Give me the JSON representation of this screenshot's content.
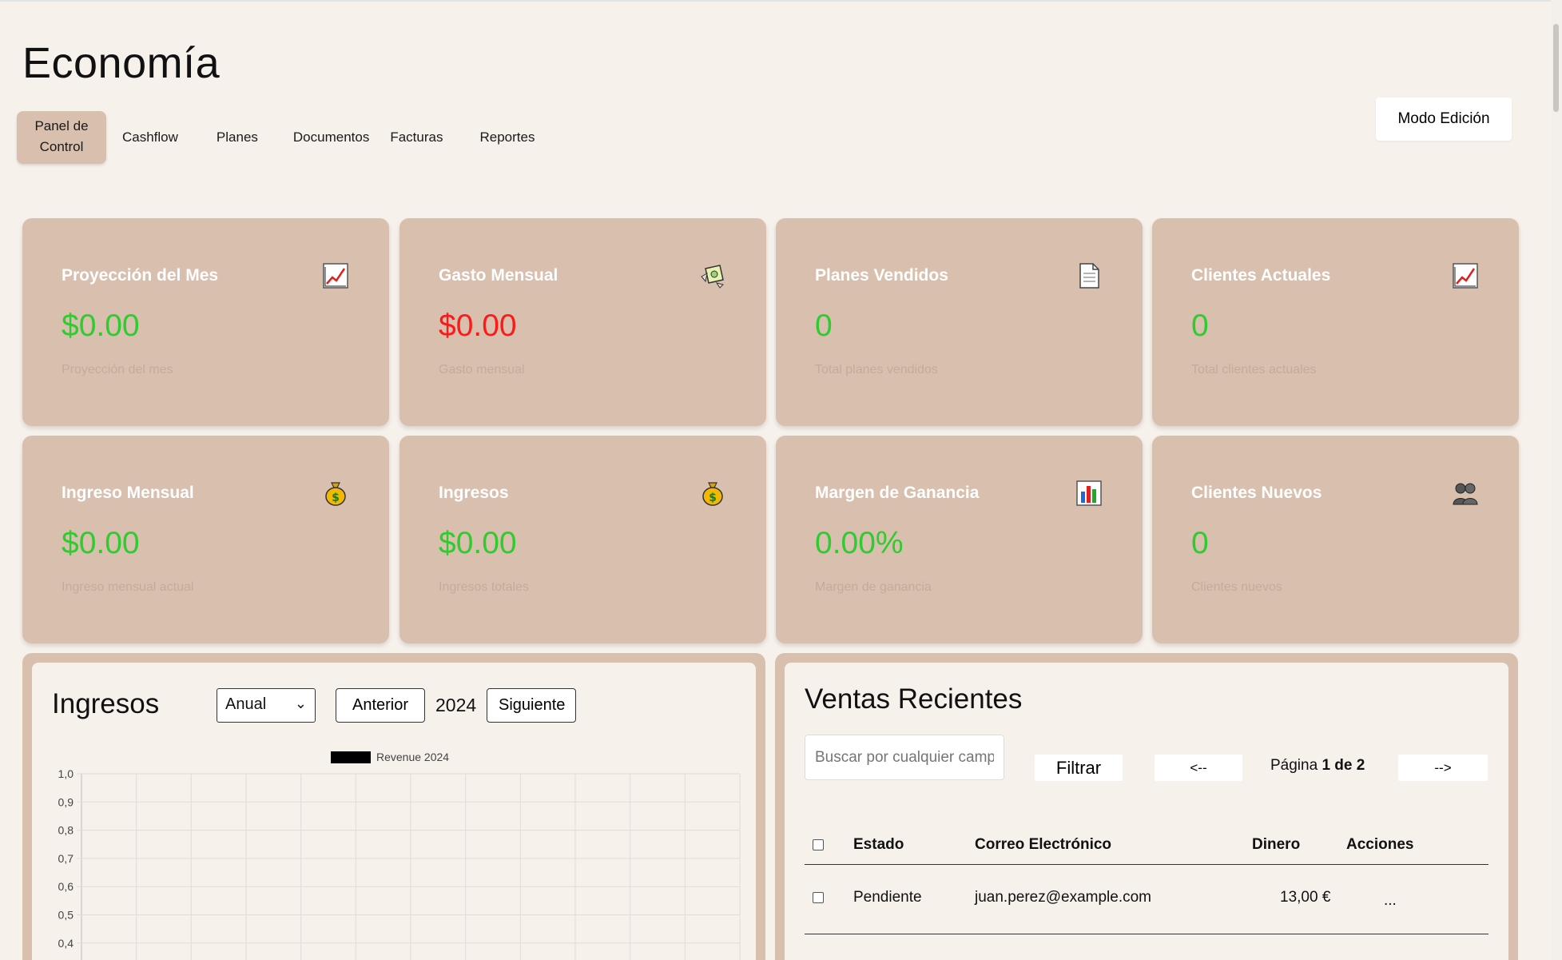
{
  "app": {
    "title": "Economía",
    "mode_button": "Modo Edición"
  },
  "tabs": [
    {
      "label": "Panel de\nControl",
      "active": true
    },
    {
      "label": "Cashflow",
      "active": false
    },
    {
      "label": "Planes",
      "active": false
    },
    {
      "label": "Documentos",
      "active": false
    },
    {
      "label": "Facturas",
      "active": false
    },
    {
      "label": "Reportes",
      "active": false
    }
  ],
  "cards": [
    {
      "title": "Proyección del Mes",
      "value": "$0.00",
      "subtitle": "Proyección del mes",
      "icon": "chart-increasing-icon",
      "value_color": "green"
    },
    {
      "title": "Gasto Mensual",
      "value": "$0.00",
      "subtitle": "Gasto mensual",
      "icon": "money-with-wings-icon",
      "value_color": "red"
    },
    {
      "title": "Planes Vendidos",
      "value": "0",
      "subtitle": "Total planes vendidos",
      "icon": "document-icon",
      "value_color": "green"
    },
    {
      "title": "Clientes Actuales",
      "value": "0",
      "subtitle": "Total clientes actuales",
      "icon": "chart-increasing-icon",
      "value_color": "green"
    },
    {
      "title": "Ingreso Mensual",
      "value": "$0.00",
      "subtitle": "Ingreso mensual actual",
      "icon": "money-bag-icon",
      "value_color": "green"
    },
    {
      "title": "Ingresos",
      "value": "$0.00",
      "subtitle": "Ingresos totales",
      "icon": "money-bag-icon",
      "value_color": "green"
    },
    {
      "title": "Margen de Ganancia",
      "value": "0.00%",
      "subtitle": "Margen de ganancia",
      "icon": "bar-chart-icon",
      "value_color": "green"
    },
    {
      "title": "Clientes Nuevos",
      "value": "0",
      "subtitle": "Clientes nuevos",
      "icon": "people-icon",
      "value_color": "green"
    }
  ],
  "colors": {
    "green": "#2ecc2e",
    "red": "#ff1a1a",
    "card_bg": "#d9bfae",
    "page_bg": "#f7f1ec"
  },
  "revenue": {
    "title": "Ingresos",
    "period_select": "Anual",
    "prev_label": "Anterior",
    "year": "2024",
    "next_label": "Siguiente"
  },
  "chart_data": {
    "type": "line",
    "series": [
      {
        "name": "Revenue 2024",
        "values": []
      }
    ],
    "yticks": [
      "1,0",
      "0,9",
      "0,8",
      "0,7",
      "0,6",
      "0,5",
      "0,4"
    ],
    "ylim": [
      0,
      1.0
    ],
    "grid": true,
    "legend": "top-center"
  },
  "sales": {
    "title": "Ventas Recientes",
    "search_placeholder": "Buscar por cualquier campo",
    "filter_label": "Filtrar",
    "prev_page": "<--",
    "next_page": "-->",
    "page_prefix": "Página",
    "page_value": "1 de 2",
    "columns": [
      "Estado",
      "Correo Electrónico",
      "Dinero",
      "Acciones"
    ],
    "rows": [
      {
        "estado": "Pendiente",
        "correo": "juan.perez@example.com",
        "dinero": "13,00 €",
        "acciones": "..."
      }
    ]
  }
}
